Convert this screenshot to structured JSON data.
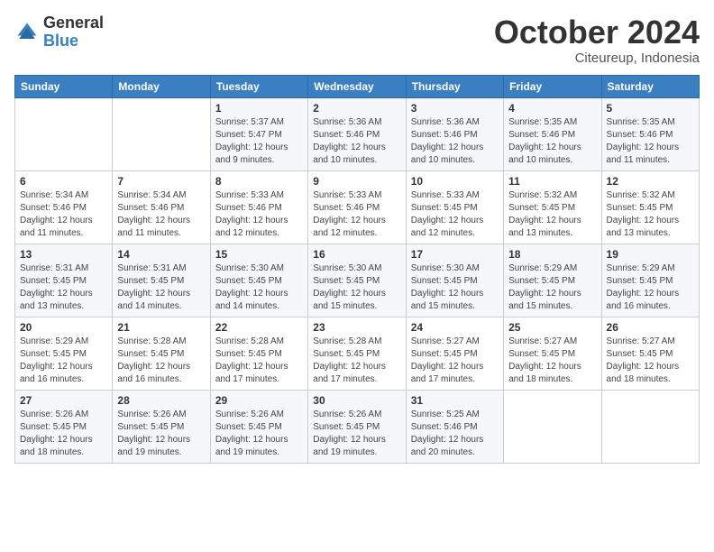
{
  "header": {
    "logo_general": "General",
    "logo_blue": "Blue",
    "month_title": "October 2024",
    "location": "Citeureup, Indonesia"
  },
  "weekdays": [
    "Sunday",
    "Monday",
    "Tuesday",
    "Wednesday",
    "Thursday",
    "Friday",
    "Saturday"
  ],
  "weeks": [
    [
      {
        "day": "",
        "info": ""
      },
      {
        "day": "",
        "info": ""
      },
      {
        "day": "1",
        "info": "Sunrise: 5:37 AM\nSunset: 5:47 PM\nDaylight: 12 hours\nand 9 minutes."
      },
      {
        "day": "2",
        "info": "Sunrise: 5:36 AM\nSunset: 5:46 PM\nDaylight: 12 hours\nand 10 minutes."
      },
      {
        "day": "3",
        "info": "Sunrise: 5:36 AM\nSunset: 5:46 PM\nDaylight: 12 hours\nand 10 minutes."
      },
      {
        "day": "4",
        "info": "Sunrise: 5:35 AM\nSunset: 5:46 PM\nDaylight: 12 hours\nand 10 minutes."
      },
      {
        "day": "5",
        "info": "Sunrise: 5:35 AM\nSunset: 5:46 PM\nDaylight: 12 hours\nand 11 minutes."
      }
    ],
    [
      {
        "day": "6",
        "info": "Sunrise: 5:34 AM\nSunset: 5:46 PM\nDaylight: 12 hours\nand 11 minutes."
      },
      {
        "day": "7",
        "info": "Sunrise: 5:34 AM\nSunset: 5:46 PM\nDaylight: 12 hours\nand 11 minutes."
      },
      {
        "day": "8",
        "info": "Sunrise: 5:33 AM\nSunset: 5:46 PM\nDaylight: 12 hours\nand 12 minutes."
      },
      {
        "day": "9",
        "info": "Sunrise: 5:33 AM\nSunset: 5:46 PM\nDaylight: 12 hours\nand 12 minutes."
      },
      {
        "day": "10",
        "info": "Sunrise: 5:33 AM\nSunset: 5:45 PM\nDaylight: 12 hours\nand 12 minutes."
      },
      {
        "day": "11",
        "info": "Sunrise: 5:32 AM\nSunset: 5:45 PM\nDaylight: 12 hours\nand 13 minutes."
      },
      {
        "day": "12",
        "info": "Sunrise: 5:32 AM\nSunset: 5:45 PM\nDaylight: 12 hours\nand 13 minutes."
      }
    ],
    [
      {
        "day": "13",
        "info": "Sunrise: 5:31 AM\nSunset: 5:45 PM\nDaylight: 12 hours\nand 13 minutes."
      },
      {
        "day": "14",
        "info": "Sunrise: 5:31 AM\nSunset: 5:45 PM\nDaylight: 12 hours\nand 14 minutes."
      },
      {
        "day": "15",
        "info": "Sunrise: 5:30 AM\nSunset: 5:45 PM\nDaylight: 12 hours\nand 14 minutes."
      },
      {
        "day": "16",
        "info": "Sunrise: 5:30 AM\nSunset: 5:45 PM\nDaylight: 12 hours\nand 15 minutes."
      },
      {
        "day": "17",
        "info": "Sunrise: 5:30 AM\nSunset: 5:45 PM\nDaylight: 12 hours\nand 15 minutes."
      },
      {
        "day": "18",
        "info": "Sunrise: 5:29 AM\nSunset: 5:45 PM\nDaylight: 12 hours\nand 15 minutes."
      },
      {
        "day": "19",
        "info": "Sunrise: 5:29 AM\nSunset: 5:45 PM\nDaylight: 12 hours\nand 16 minutes."
      }
    ],
    [
      {
        "day": "20",
        "info": "Sunrise: 5:29 AM\nSunset: 5:45 PM\nDaylight: 12 hours\nand 16 minutes."
      },
      {
        "day": "21",
        "info": "Sunrise: 5:28 AM\nSunset: 5:45 PM\nDaylight: 12 hours\nand 16 minutes."
      },
      {
        "day": "22",
        "info": "Sunrise: 5:28 AM\nSunset: 5:45 PM\nDaylight: 12 hours\nand 17 minutes."
      },
      {
        "day": "23",
        "info": "Sunrise: 5:28 AM\nSunset: 5:45 PM\nDaylight: 12 hours\nand 17 minutes."
      },
      {
        "day": "24",
        "info": "Sunrise: 5:27 AM\nSunset: 5:45 PM\nDaylight: 12 hours\nand 17 minutes."
      },
      {
        "day": "25",
        "info": "Sunrise: 5:27 AM\nSunset: 5:45 PM\nDaylight: 12 hours\nand 18 minutes."
      },
      {
        "day": "26",
        "info": "Sunrise: 5:27 AM\nSunset: 5:45 PM\nDaylight: 12 hours\nand 18 minutes."
      }
    ],
    [
      {
        "day": "27",
        "info": "Sunrise: 5:26 AM\nSunset: 5:45 PM\nDaylight: 12 hours\nand 18 minutes."
      },
      {
        "day": "28",
        "info": "Sunrise: 5:26 AM\nSunset: 5:45 PM\nDaylight: 12 hours\nand 19 minutes."
      },
      {
        "day": "29",
        "info": "Sunrise: 5:26 AM\nSunset: 5:45 PM\nDaylight: 12 hours\nand 19 minutes."
      },
      {
        "day": "30",
        "info": "Sunrise: 5:26 AM\nSunset: 5:45 PM\nDaylight: 12 hours\nand 19 minutes."
      },
      {
        "day": "31",
        "info": "Sunrise: 5:25 AM\nSunset: 5:46 PM\nDaylight: 12 hours\nand 20 minutes."
      },
      {
        "day": "",
        "info": ""
      },
      {
        "day": "",
        "info": ""
      }
    ]
  ]
}
